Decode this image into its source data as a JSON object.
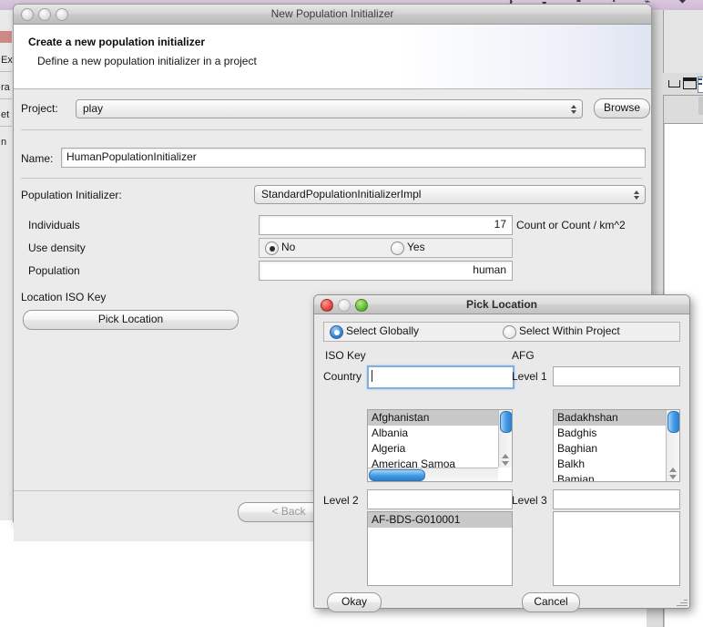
{
  "desktop": {
    "menubar_icons": "◑ ◒ ◓ ◔ ⌁ ⏷",
    "bg_fragments": [
      "Ex",
      "ra",
      "et",
      "n"
    ]
  },
  "main_window": {
    "title": "New Population Initializer",
    "traffic_lights": [
      "close-button",
      "minimize-button",
      "zoom-button"
    ],
    "header": {
      "title": "Create a new population initializer",
      "subtitle": "Define a new population initializer in a project"
    },
    "fields": {
      "project_label": "Project:",
      "project_value": "play",
      "browse_label": "Browse",
      "name_label": "Name:",
      "name_value": "HumanPopulationInitializer",
      "initializer_label": "Population Initializer:",
      "initializer_value": "StandardPopulationInitializerImpl",
      "individuals_label": "Individuals",
      "individuals_value": "17",
      "individuals_unit": "Count or Count / km^2",
      "use_density_label": "Use density",
      "use_density_no": "No",
      "use_density_yes": "Yes",
      "use_density_selected": "No",
      "population_label": "Population",
      "population_value": "human",
      "location_iso_label": "Location ISO Key",
      "pick_location_label": "Pick Location"
    },
    "footer": {
      "back_label": "< Back"
    }
  },
  "pick_location_dialog": {
    "title": "Pick Location",
    "traffic_lights": [
      "close-button",
      "minimize-button",
      "zoom-button"
    ],
    "scope": {
      "global_label": "Select Globally",
      "project_label": "Select Within Project",
      "selected": "Select Globally"
    },
    "iso_key_label": "ISO Key",
    "iso_key_value": "AFG",
    "country": {
      "label": "Country",
      "input_value": "",
      "items": [
        "Afghanistan",
        "Albania",
        "Algeria",
        "American Samoa"
      ],
      "selected": "Afghanistan"
    },
    "level1": {
      "label": "Level 1",
      "input_value": "",
      "items": [
        "Badakhshan",
        "Badghis",
        "Baghian",
        "Balkh",
        "Bamian"
      ],
      "selected": "Badakhshan"
    },
    "level2": {
      "label": "Level 2",
      "input_value": "",
      "items": [
        "AF-BDS-G010001"
      ],
      "selected": "AF-BDS-G010001"
    },
    "level3": {
      "label": "Level 3",
      "input_value": "",
      "items": []
    },
    "buttons": {
      "okay_label": "Okay",
      "cancel_label": "Cancel"
    }
  }
}
